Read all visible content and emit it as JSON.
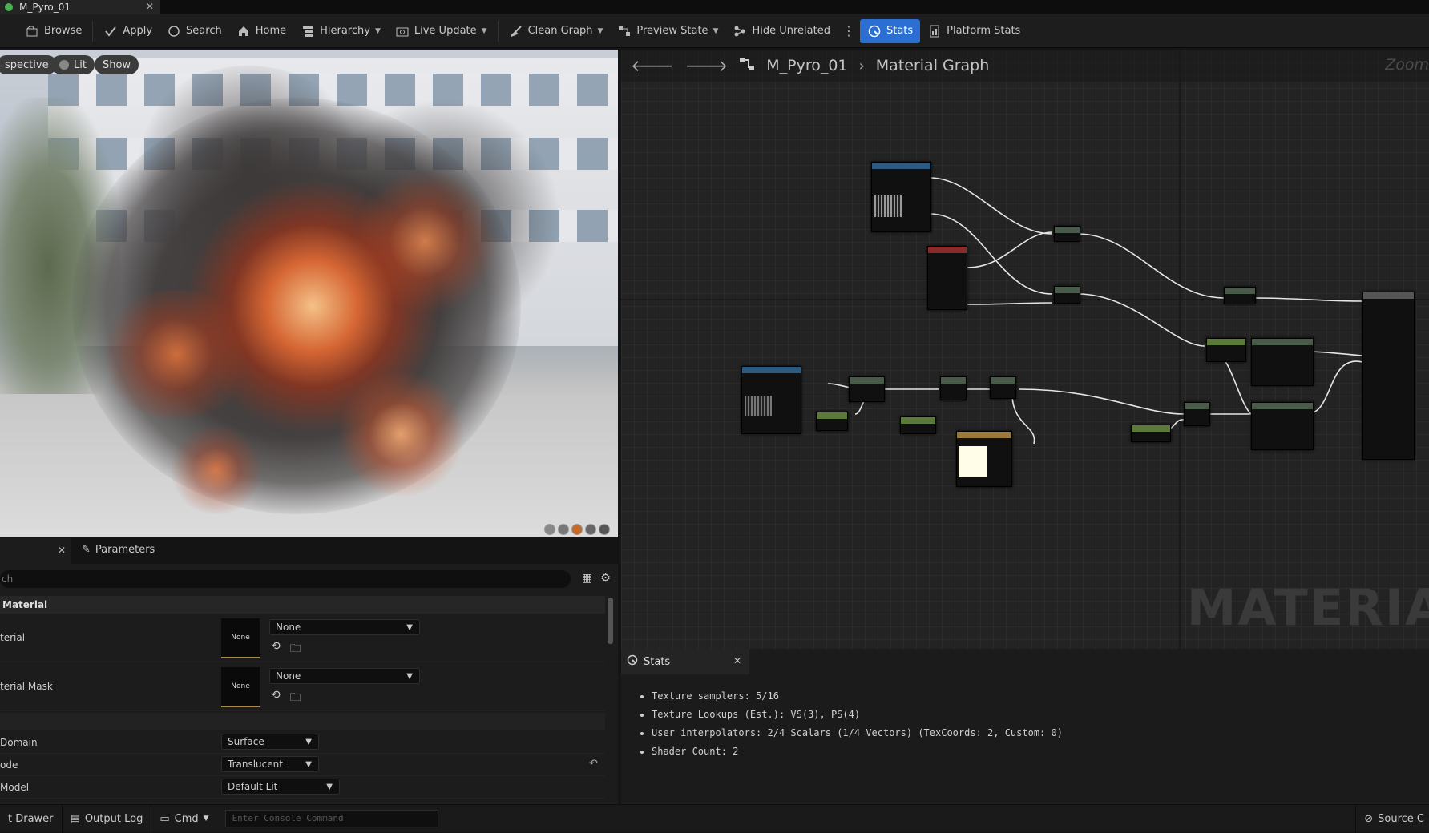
{
  "tab": {
    "title": "M_Pyro_01"
  },
  "toolbar": {
    "items": [
      {
        "label": "Browse",
        "icon": "browse-icon"
      },
      {
        "label": "Apply",
        "icon": "apply-icon"
      },
      {
        "label": "Search",
        "icon": "search-icon"
      },
      {
        "label": "Home",
        "icon": "home-icon"
      },
      {
        "label": "Hierarchy",
        "icon": "hierarchy-icon"
      },
      {
        "label": "Live Update",
        "icon": "live-update-icon"
      },
      {
        "label": "Clean Graph",
        "icon": "clean-graph-icon"
      },
      {
        "label": "Preview State",
        "icon": "preview-state-icon"
      },
      {
        "label": "Hide Unrelated",
        "icon": "hide-unrelated-icon"
      },
      {
        "label": "Stats",
        "icon": "stats-icon"
      },
      {
        "label": "Platform Stats",
        "icon": "platform-stats-icon"
      }
    ]
  },
  "viewport": {
    "perspective": "spective",
    "lit": "Lit",
    "show": "Show"
  },
  "graph": {
    "breadcrumb": {
      "material": "M_Pyro_01",
      "graph": "Material Graph"
    },
    "zoom": "Zoom",
    "watermark": "MATERIA"
  },
  "details": {
    "params_tab": "Parameters",
    "search_placeholder": "ch",
    "section": "Material",
    "rows": [
      {
        "label": "terial",
        "thumb": "None",
        "value": "None"
      },
      {
        "label": "terial Mask",
        "thumb": "None",
        "value": "None"
      }
    ],
    "domain": {
      "label": "Domain",
      "value": "Surface"
    },
    "blend": {
      "label": "ode",
      "value": "Translucent"
    },
    "shading": {
      "label": "Model",
      "value": "Default Lit"
    }
  },
  "stats": {
    "tab": "Stats",
    "lines": [
      "Texture samplers: 5/16",
      "Texture Lookups (Est.): VS(3), PS(4)",
      "User interpolators: 2/4 Scalars (1/4 Vectors) (TexCoords: 2, Custom: 0)",
      "Shader Count: 2"
    ]
  },
  "statusbar": {
    "drawer": "t Drawer",
    "output_log": "Output Log",
    "cmd": "Cmd",
    "console_placeholder": "Enter Console Command",
    "source_control": "Source C"
  },
  "colors": {
    "accent": "#2a6fd1",
    "panel": "#1c1c1c",
    "graph_bg": "#232323"
  }
}
